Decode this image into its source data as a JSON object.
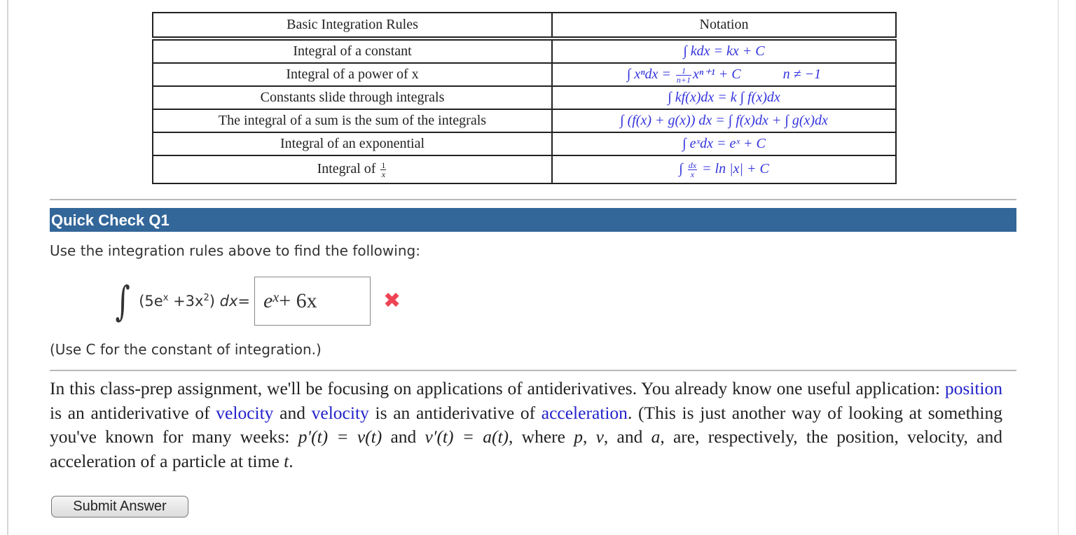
{
  "rules_table": {
    "headers": [
      "Basic Integration Rules",
      "Notation"
    ],
    "rows": [
      {
        "rule": "Integral of a constant",
        "notation": "∫ kdx = kx + C"
      },
      {
        "rule": "Integral of a power of x",
        "notation_pre": "∫ xⁿdx = ",
        "frac_num": "1",
        "frac_den": "n+1",
        "notation_post": "xⁿ⁺¹ + C",
        "condition": "n ≠ −1"
      },
      {
        "rule": "Constants slide through integrals",
        "notation": "∫ kf(x)dx = k ∫ f(x)dx"
      },
      {
        "rule": "The integral of a sum is the sum of the integrals",
        "notation": "∫ (f(x) + g(x)) dx = ∫ f(x)dx + ∫ g(x)dx"
      },
      {
        "rule": "Integral of an exponential",
        "notation": "∫ eˣdx = eˣ + C"
      },
      {
        "rule_pre": "Integral of ",
        "rule_frac_num": "1",
        "rule_frac_den": "x",
        "notation_pre": "∫ ",
        "frac_num": "dx",
        "frac_den": "x",
        "notation_post": " = ln |x| + C"
      }
    ]
  },
  "quick_check": {
    "title": "Quick Check Q1",
    "prompt": "Use the integration rules above to find the following:",
    "integral_sign": "∫",
    "expression": {
      "open": "(5e",
      "sup1": "x",
      "mid": " +3x",
      "sup2": "2",
      "close": ")",
      "dx": "dx",
      "equals": "="
    },
    "answer": {
      "base": "e",
      "sup": "x",
      "rest": " + 6x"
    },
    "status": "incorrect",
    "status_icon": "✖",
    "hint": "(Use C for the constant of integration.)",
    "submit_label": "Submit Answer"
  },
  "paragraph": {
    "s1": "In this class-prep assignment, we'll be focusing on applications of antiderivatives. You already know one useful application: ",
    "link1": "position",
    "s2": " is an antiderivative of ",
    "link2": "velocity",
    "s3": " and ",
    "link3": "velocity",
    "s4": " is an antiderivative of ",
    "link4": "acceleration",
    "s5": ". (This is just another way of looking at something you've known for many weeks: ",
    "m1": "p′(t) = v(t)",
    "s6": " and ",
    "m2": "v′(t) = a(t)",
    "s7": ", where ",
    "m3": "p",
    "s8": ", ",
    "m4": "v",
    "s9": ", and ",
    "m5": "a",
    "s10": ", are, respectively, the position, velocity, and acceleration of a particle at time ",
    "m6": "t",
    "s11": "."
  },
  "colors": {
    "header_bg": "#336699",
    "math_blue": "#3333dd",
    "link_blue": "#2222cc",
    "error_red": "#ee4455"
  }
}
